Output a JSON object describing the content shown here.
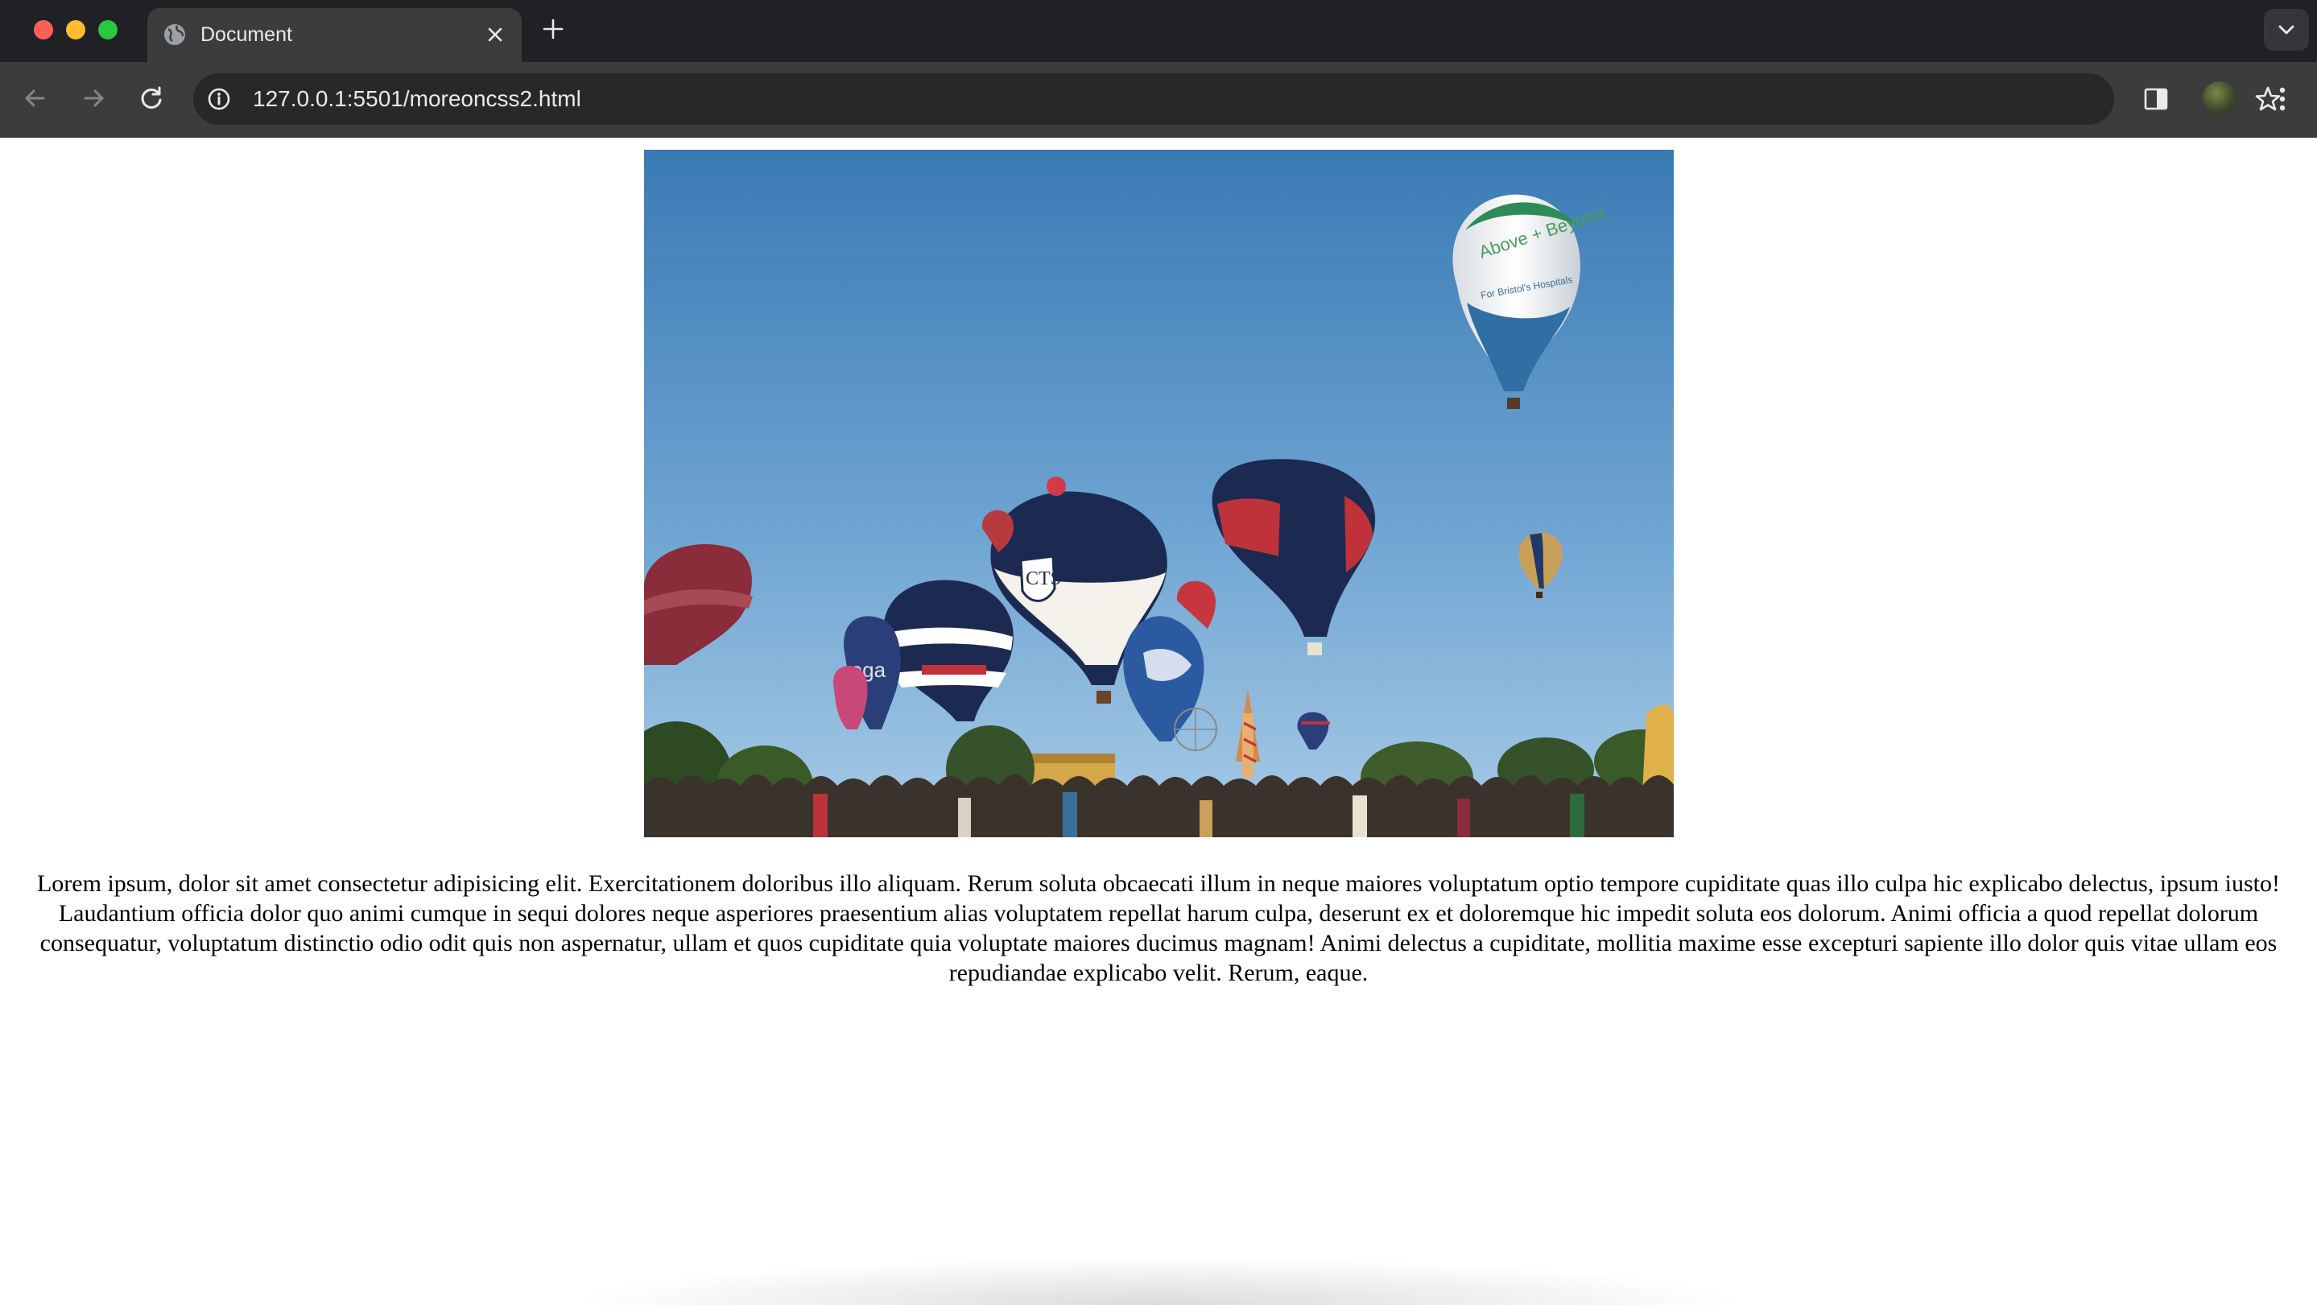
{
  "browser": {
    "tab_title": "Document",
    "url": "127.0.0.1:5501/moreoncss2.html"
  },
  "page": {
    "image": {
      "balloon_texts": {
        "shield": "CTS",
        "above_beyond": "Above + Beyond",
        "hospital": "For Bristol's Hospitals",
        "stripe_left": "rega"
      }
    },
    "paragraph": "Lorem ipsum, dolor sit amet consectetur adipisicing elit. Exercitationem doloribus illo aliquam. Rerum soluta obcaecati illum in neque maiores voluptatum optio tempore cupiditate quas illo culpa hic explicabo delectus, ipsum iusto! Laudantium officia dolor quo animi cumque in sequi dolores neque asperiores praesentium alias voluptatem repellat harum culpa, deserunt ex et doloremque hic impedit soluta eos dolorum. Animi officia a quod repellat dolorum consequatur, voluptatum distinctio odio odit quis non aspernatur, ullam et quos cupiditate quia voluptate maiores ducimus magnam! Animi delectus a cupiditate, mollitia maxime esse excepturi sapiente illo dolor quis vitae ullam eos repudiandae explicabo velit. Rerum, eaque."
  },
  "icons": {
    "tab": "globe-icon",
    "close": "close-icon",
    "new_tab": "plus-icon",
    "tab_search": "chevron-down-icon",
    "back": "arrow-left-icon",
    "forward": "arrow-right-icon",
    "reload": "reload-icon",
    "site_info": "info-icon",
    "bookmark": "star-icon",
    "side_panel": "side-panel-icon",
    "menu": "kebab-menu-icon"
  },
  "colors": {
    "tabstrip": "#202124",
    "toolbar": "#3c3c3c",
    "omnibox": "#282828",
    "sky": "#4f8fc6"
  }
}
